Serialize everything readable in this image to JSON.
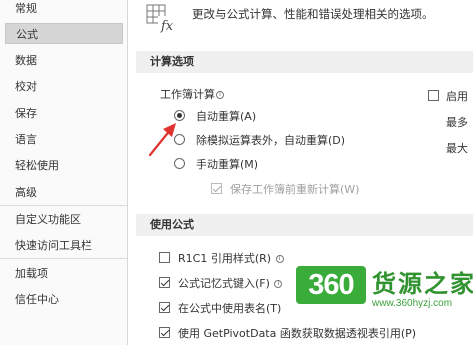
{
  "sidebar": {
    "items": [
      {
        "label": "常规"
      },
      {
        "label": "公式",
        "active": true
      },
      {
        "label": "数据"
      },
      {
        "label": "校对"
      },
      {
        "label": "保存"
      },
      {
        "label": "语言"
      },
      {
        "label": "轻松使用"
      },
      {
        "label": "高级"
      },
      {
        "label": "自定义功能区"
      },
      {
        "label": "快速访问工具栏"
      },
      {
        "label": "加载项"
      },
      {
        "label": "信任中心"
      }
    ]
  },
  "header": {
    "icon": "formula-fx-icon",
    "text": "更改与公式计算、性能和错误处理相关的选项。"
  },
  "calc_options": {
    "title": "计算选项",
    "workbook_calc_label": "工作簿计算",
    "automatic": "自动重算(A)",
    "auto_except_tables": "除模拟运算表外，自动重算(D)",
    "manual": "手动重算(M)",
    "recalc_before_save": "保存工作簿前重新计算(W)",
    "selected": "automatic",
    "right_checkbox_label": "启用",
    "right_label_1": "最多",
    "right_label_2": "最大"
  },
  "formulas": {
    "title": "使用公式",
    "r1c1": "R1C1 引用样式(R)",
    "autocomplete": "公式记忆式键入(F)",
    "table_names": "在公式中使用表名(T)",
    "getpivotdata": "使用 GetPivotData 函数获取数据透视表引用(P)"
  },
  "watermark": {
    "badge": "360",
    "title": "货源之家",
    "url": "www.360hyzj.com"
  },
  "colors": {
    "arrow": "#e0332f",
    "watermark_green": "#2aa52a"
  }
}
